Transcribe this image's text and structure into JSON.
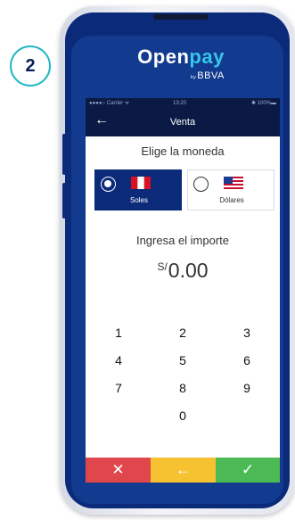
{
  "step": {
    "number": "2",
    "accent_color": "#22b7c4"
  },
  "logo": {
    "word_main": "Open",
    "word_accent": "pay",
    "by": "by",
    "sub": "BBVA",
    "accent_color": "#36c6e8"
  },
  "status_bar": {
    "carrier": "●●●●○ Carrier ᯤ",
    "time": "13:20",
    "battery": "✱ 100%▬"
  },
  "nav": {
    "back_icon": "←",
    "title": "Venta"
  },
  "currency": {
    "prompt": "Elige la moneda",
    "options": [
      {
        "label": "Soles",
        "selected": true,
        "flag": "peru-flag-icon"
      },
      {
        "label": "Dólares",
        "selected": false,
        "flag": "usa-flag-icon"
      }
    ]
  },
  "amount": {
    "prompt": "Ingresa el importe",
    "symbol": "S/",
    "value": "0.00"
  },
  "keypad": {
    "keys": [
      "1",
      "2",
      "3",
      "4",
      "5",
      "6",
      "7",
      "8",
      "9",
      "0"
    ]
  },
  "actions": {
    "cancel": {
      "icon": "✕",
      "color": "#e0474c"
    },
    "delete": {
      "icon": "←",
      "color": "#f6c232"
    },
    "confirm": {
      "icon": "✓",
      "color": "#4bb954"
    }
  }
}
